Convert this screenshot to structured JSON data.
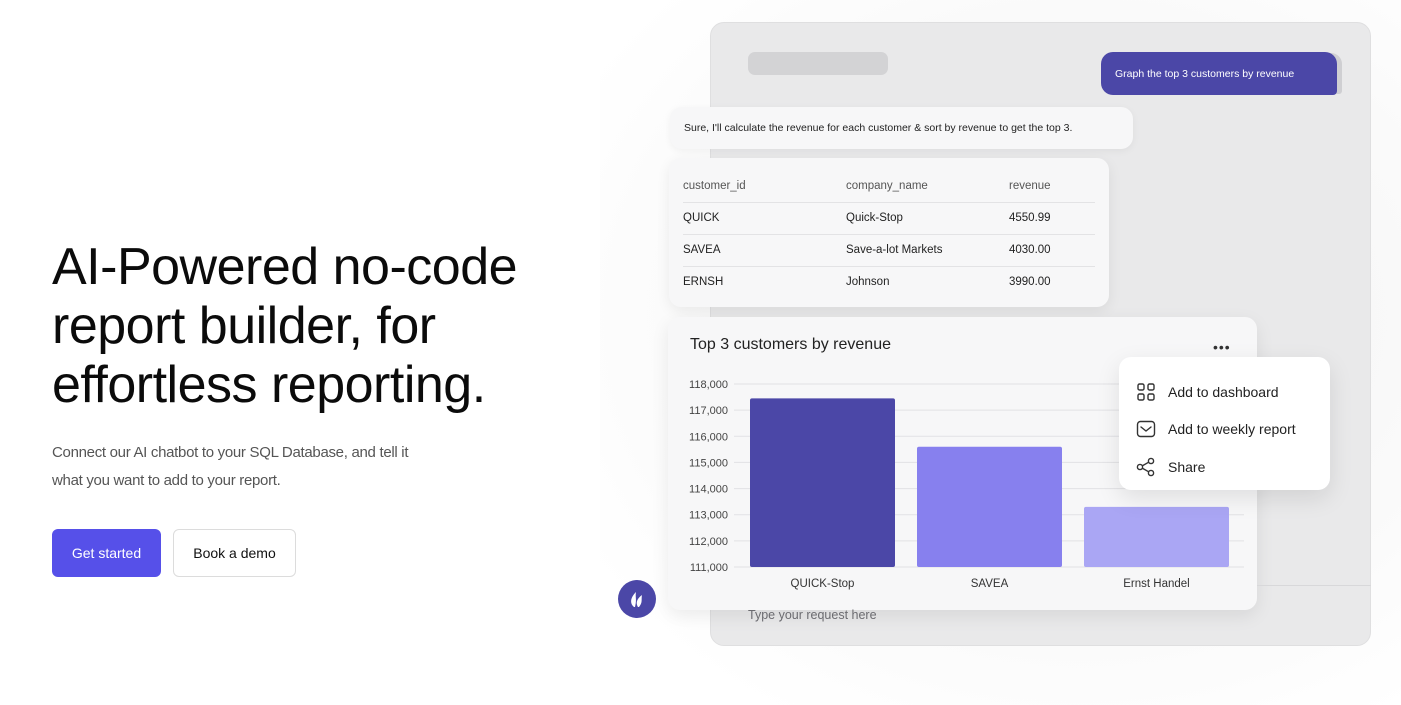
{
  "hero": {
    "title_lines": [
      "AI-Powered no-code",
      "report builder, for",
      "effortless reporting."
    ],
    "description": "Connect our AI chatbot to your SQL Database, and tell it what you want to add to your report.",
    "primary_button": "Get started",
    "secondary_button": "Book a demo"
  },
  "chat": {
    "user_message": "Graph the top 3 customers by revenue",
    "bot_message": "Sure, I'll calculate the revenue for each customer & sort by revenue to get the top 3.",
    "input_placeholder": "Type your request here"
  },
  "table": {
    "columns": [
      "customer_id",
      "company_name",
      "revenue"
    ],
    "rows": [
      [
        "QUICK",
        "Quick-Stop",
        "4550.99"
      ],
      [
        "SAVEA",
        "Save-a-lot Markets",
        "4030.00"
      ],
      [
        "ERNSH",
        "Johnson",
        "3990.00"
      ]
    ]
  },
  "chart_data": {
    "type": "bar",
    "title": "Top 3 customers by revenue",
    "categories": [
      "QUICK-Stop",
      "SAVEA",
      "Ernst Handel"
    ],
    "values": [
      117450,
      115600,
      113300
    ],
    "ylim": [
      111000,
      118000
    ],
    "yticks": [
      "118,000",
      "117,000",
      "116,000",
      "115,000",
      "114,000",
      "113,000",
      "112,000",
      "111,000"
    ],
    "bar_colors": [
      "#4b47a7",
      "#8780ee",
      "#aaa6f4"
    ],
    "grid": true,
    "xlabel": "",
    "ylabel": ""
  },
  "menu": {
    "items": [
      {
        "label": "Add to dashboard",
        "icon": "grid-icon"
      },
      {
        "label": "Add to weekly report",
        "icon": "mail-icon"
      },
      {
        "label": "Share",
        "icon": "share-icon"
      }
    ]
  },
  "colors": {
    "accent": "#5650e9",
    "brand_dark": "#4b47a7"
  }
}
